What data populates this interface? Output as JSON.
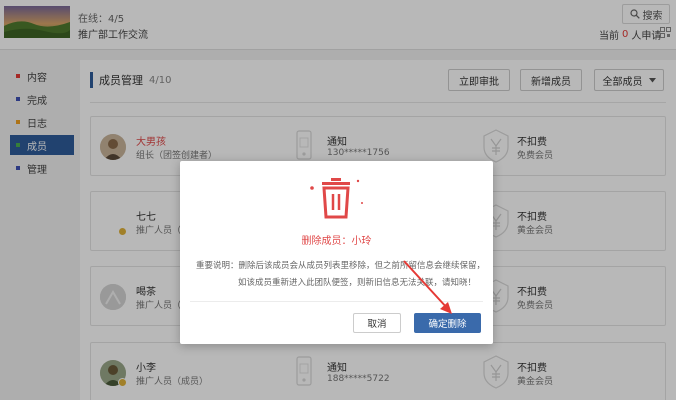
{
  "header": {
    "online": "在线：4/5",
    "group_name": "推广部工作交流",
    "search_label": "搜索",
    "apply_prefix": "当前",
    "apply_count": "0",
    "apply_suffix": "人申请"
  },
  "sidebar": {
    "items": [
      {
        "label": "内容",
        "color": "#e53935"
      },
      {
        "label": "完成",
        "color": "#3f51b5"
      },
      {
        "label": "日志",
        "color": "#f0a020"
      },
      {
        "label": "成员",
        "color": "#4caf50"
      },
      {
        "label": "管理",
        "color": "#3f51b5"
      }
    ]
  },
  "main": {
    "title": "成员管理",
    "count": "4/10",
    "btn_review": "立即审批",
    "btn_add": "新增成员",
    "btn_all": "全部成员"
  },
  "members": [
    {
      "name": "大男孩",
      "role": "组长（团签创建者）",
      "notify": "通知",
      "phone": "130*****1756",
      "fee": "不扣费",
      "member": "免费会员"
    },
    {
      "name": "七七",
      "role": "推广人员（",
      "notify": "",
      "phone": "",
      "fee": "不扣费",
      "member": "黄金会员"
    },
    {
      "name": "喝茶",
      "role": "推广人员（",
      "notify": "",
      "phone": "",
      "fee": "不扣费",
      "member": "免费会员"
    },
    {
      "name": "小李",
      "role": "推广人员（成员）",
      "notify": "通知",
      "phone": "188*****5722",
      "fee": "不扣费",
      "member": "黄金会员"
    }
  ],
  "modal": {
    "title": "删除成员：小玲",
    "notice_line1": "重要说明：删除后该成员会从成员列表里移除，但之前所留信息会继续保留，",
    "notice_line2": "如该成员重新进入此团队便签，则新旧信息无法关联，请知晓！",
    "cancel": "取消",
    "confirm": "确定删除"
  },
  "colors": {
    "accent": "#2e5c9a",
    "danger": "#e04848",
    "confirm": "#3a6aab"
  }
}
